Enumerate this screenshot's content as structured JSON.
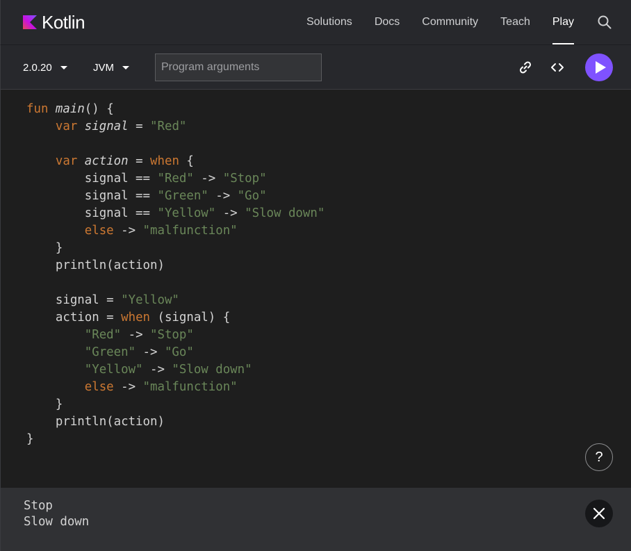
{
  "brand": {
    "name": "Kotlin",
    "accent_color": "#7f52ff"
  },
  "nav": {
    "links": [
      {
        "label": "Solutions",
        "active": false
      },
      {
        "label": "Docs",
        "active": false
      },
      {
        "label": "Community",
        "active": false
      },
      {
        "label": "Teach",
        "active": false
      },
      {
        "label": "Play",
        "active": true
      }
    ],
    "search_icon": "search-icon"
  },
  "toolbar": {
    "version": "2.0.20",
    "platform": "JVM",
    "args_placeholder": "Program arguments",
    "args_value": "",
    "icons": [
      "link-icon",
      "code-brackets-icon",
      "play-icon"
    ]
  },
  "editor": {
    "colors": {
      "keyword": "#cc7832",
      "string": "#6a8759",
      "text": "#d4d4d4",
      "background": "#1e1e1e"
    },
    "lines": [
      [
        {
          "t": "fun",
          "k": "kw"
        },
        {
          "t": " "
        },
        {
          "t": "main",
          "k": "it"
        },
        {
          "t": "() {"
        }
      ],
      [
        {
          "t": "    "
        },
        {
          "t": "var",
          "k": "kw"
        },
        {
          "t": " "
        },
        {
          "t": "signal",
          "k": "it"
        },
        {
          "t": " = "
        },
        {
          "t": "\"Red\"",
          "k": "str"
        }
      ],
      [],
      [
        {
          "t": "    "
        },
        {
          "t": "var",
          "k": "kw"
        },
        {
          "t": " "
        },
        {
          "t": "action",
          "k": "it"
        },
        {
          "t": " = "
        },
        {
          "t": "when",
          "k": "kw"
        },
        {
          "t": " {"
        }
      ],
      [
        {
          "t": "        signal == "
        },
        {
          "t": "\"Red\"",
          "k": "str"
        },
        {
          "t": " -> "
        },
        {
          "t": "\"Stop\"",
          "k": "str"
        }
      ],
      [
        {
          "t": "        signal == "
        },
        {
          "t": "\"Green\"",
          "k": "str"
        },
        {
          "t": " -> "
        },
        {
          "t": "\"Go\"",
          "k": "str"
        }
      ],
      [
        {
          "t": "        signal == "
        },
        {
          "t": "\"Yellow\"",
          "k": "str"
        },
        {
          "t": " -> "
        },
        {
          "t": "\"Slow down\"",
          "k": "str"
        }
      ],
      [
        {
          "t": "        "
        },
        {
          "t": "else",
          "k": "kw"
        },
        {
          "t": " -> "
        },
        {
          "t": "\"malfunction\"",
          "k": "str"
        }
      ],
      [
        {
          "t": "    }"
        }
      ],
      [
        {
          "t": "    println(action)"
        }
      ],
      [],
      [
        {
          "t": "    signal = "
        },
        {
          "t": "\"Yellow\"",
          "k": "str"
        }
      ],
      [
        {
          "t": "    action = "
        },
        {
          "t": "when",
          "k": "kw"
        },
        {
          "t": " (signal) {"
        }
      ],
      [
        {
          "t": "        "
        },
        {
          "t": "\"Red\"",
          "k": "str"
        },
        {
          "t": " -> "
        },
        {
          "t": "\"Stop\"",
          "k": "str"
        }
      ],
      [
        {
          "t": "        "
        },
        {
          "t": "\"Green\"",
          "k": "str"
        },
        {
          "t": " -> "
        },
        {
          "t": "\"Go\"",
          "k": "str"
        }
      ],
      [
        {
          "t": "        "
        },
        {
          "t": "\"Yellow\"",
          "k": "str"
        },
        {
          "t": " -> "
        },
        {
          "t": "\"Slow down\"",
          "k": "str"
        }
      ],
      [
        {
          "t": "        "
        },
        {
          "t": "else",
          "k": "kw"
        },
        {
          "t": " -> "
        },
        {
          "t": "\"malfunction\"",
          "k": "str"
        }
      ],
      [
        {
          "t": "    }"
        }
      ],
      [
        {
          "t": "    println(action)"
        }
      ],
      [
        {
          "t": "}"
        }
      ]
    ],
    "help_label": "?"
  },
  "output": {
    "lines": [
      "Stop",
      "Slow down"
    ],
    "close_icon": "close-icon"
  }
}
